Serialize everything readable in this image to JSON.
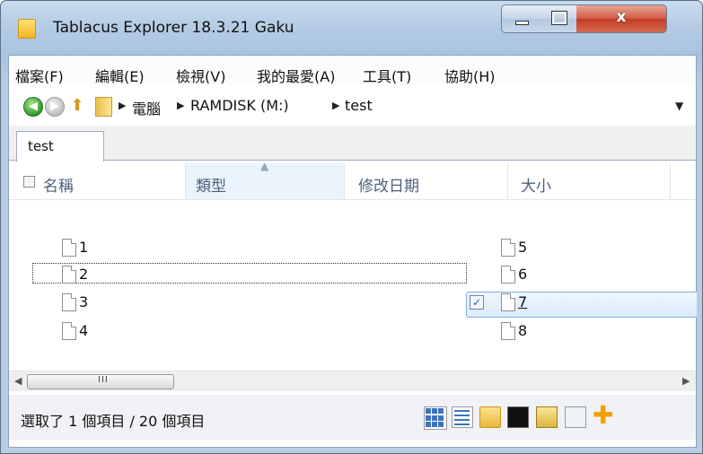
{
  "window": {
    "title": "Tablacus Explorer 18.3.21 Gaku",
    "controls": {
      "minimize": "minimize-icon",
      "maximize": "maximize-icon",
      "close": "x"
    }
  },
  "menu": [
    "檔案(F)",
    "編輯(E)",
    "檢視(V)",
    "我的最愛(A)",
    "工具(T)",
    "協助(H)"
  ],
  "address": {
    "crumbs": [
      "電腦",
      "RAMDISK (M:)",
      "test"
    ],
    "icons": [
      "back-icon",
      "forward-icon",
      "up-icon",
      "folder-icon"
    ]
  },
  "tabs": [
    {
      "label": "test",
      "active": true
    }
  ],
  "columns": {
    "name": "名稱",
    "type": "類型",
    "modified": "修改日期",
    "size": "大小",
    "sorted_by": "類型"
  },
  "files_left": [
    "1",
    "2",
    "3",
    "4"
  ],
  "files_right": [
    "5",
    "6",
    "7",
    "8"
  ],
  "state": {
    "focused": "2",
    "selected": "7",
    "selected_checked": true
  },
  "scrollbar": {
    "grip": "III"
  },
  "status": {
    "text": "選取了 1 個項目 / 20 個項目",
    "tools": [
      "large-icons-view-icon",
      "details-view-icon",
      "new-folder-icon",
      "command-prompt-icon",
      "properties-icon",
      "paste-shortcut-icon",
      "add-icon"
    ]
  },
  "colors": {
    "titlebar": "#b4cbe4",
    "close_button": "#c23c22",
    "selection": "#d9ecfc",
    "header_text": "#4c607a"
  }
}
